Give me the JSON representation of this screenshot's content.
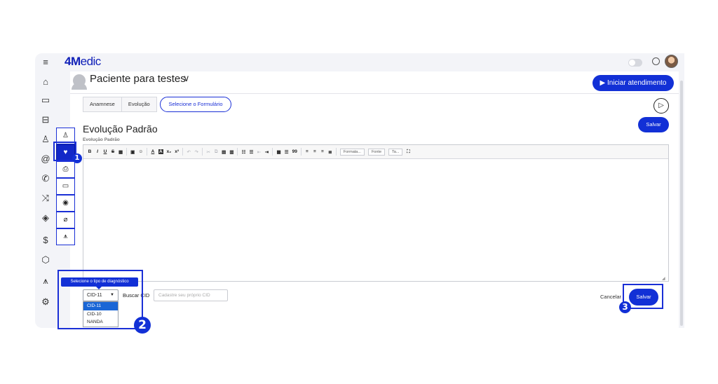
{
  "app": {
    "logo_bold": "4M",
    "logo_rest": "edic"
  },
  "rail": {
    "icons": [
      "menu-icon",
      "home-icon",
      "calendar-icon",
      "sofa-icon",
      "users-icon",
      "at-icon",
      "phone-icon",
      "shuffle-icon",
      "tag-icon",
      "dollar-icon",
      "box-icon",
      "chart-icon",
      "settings-icon"
    ],
    "menu_glyph": "≡",
    "home_glyph": "⌂",
    "calendar_glyph": "▭",
    "sofa_glyph": "⊟",
    "users_glyph": "♙",
    "at_glyph": "@",
    "phone_glyph": "✆",
    "shuffle_glyph": "⤨",
    "tag_glyph": "◈",
    "dollar_glyph": "$",
    "box_glyph": "⬡",
    "chart_glyph": "⩚",
    "settings_glyph": "⚙"
  },
  "patient": {
    "name": "Paciente para testes",
    "chevron": "∨"
  },
  "header": {
    "start_button": "▶ Iniciar atendimento"
  },
  "tabs": {
    "anamnese": "Anamnese",
    "evolucao": "Evolução",
    "selecione": "Selecione o Formulário"
  },
  "subnav": {
    "items": [
      "person-icon",
      "heart-pulse-icon",
      "printer-icon",
      "folder-icon",
      "camera-icon",
      "paperclip-icon",
      "chart-icon"
    ],
    "person": "♙",
    "heart": "♥",
    "printer": "⎙",
    "folder": "▭",
    "camera": "◉",
    "clip": "⌀",
    "chart": "⩚"
  },
  "form": {
    "title": "Evolução Padrão",
    "subtitle": "Evolução Padrão",
    "save_top": "Salvar",
    "send_glyph": "▷"
  },
  "toolbar": {
    "bold": "B",
    "italic": "I",
    "underline": "U",
    "strike": "S",
    "format": "Formata...",
    "font": "Fonte",
    "size": "Ta...",
    "quote": "99",
    "subscript": "x₂",
    "superscript": "x²",
    "color_text": "A",
    "color_bg": "A"
  },
  "cid": {
    "tooltip": "Selecione o tipo de diagnóstico",
    "selected": "CID-11",
    "options": [
      "CID-11",
      "CID-10",
      "NANDA"
    ],
    "search_label": "Buscar CID",
    "input_placeholder": "Cadastre seu próprio CID"
  },
  "footer": {
    "cancel": "Cancelar",
    "save": "Salvar"
  },
  "annotations": {
    "one": "1",
    "two": "2",
    "three": "3"
  },
  "colors": {
    "accent": "#1230d6",
    "highlight": "#1a2fd6",
    "panel_bg": "#f3f4f8"
  }
}
